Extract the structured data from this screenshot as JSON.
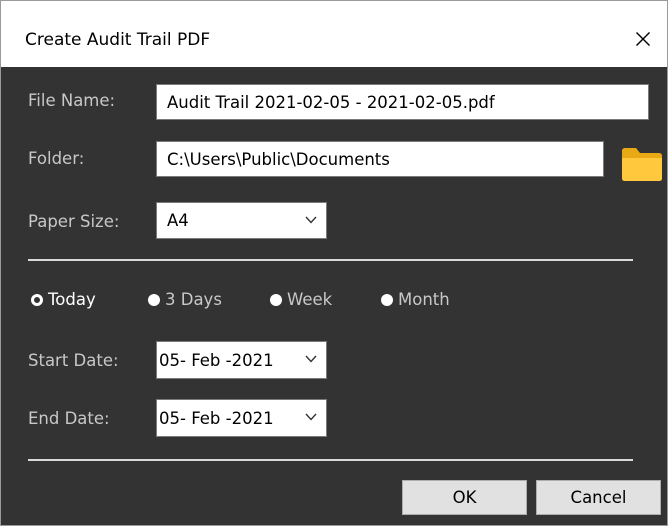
{
  "dialog": {
    "title": "Create Audit Trail PDF",
    "close_icon": "close-icon"
  },
  "form": {
    "file_name_label": "File Name:",
    "file_name_value": "Audit Trail 2021-02-05 - 2021-02-05.pdf",
    "folder_label": "Folder:",
    "folder_value": "C:\\Users\\Public\\Documents",
    "folder_icon": "folder-icon",
    "folder_icon_color": "#ffc83d",
    "paper_size_label": "Paper Size:",
    "paper_size_value": "A4"
  },
  "range": {
    "options": [
      {
        "label": "Today",
        "selected": true
      },
      {
        "label": "3 Days",
        "selected": false
      },
      {
        "label": "Week",
        "selected": false
      },
      {
        "label": "Month",
        "selected": false
      }
    ],
    "start_date_label": "Start Date:",
    "start_date_value": "05- Feb -2021",
    "end_date_label": "End Date:",
    "end_date_value": "05- Feb -2021"
  },
  "buttons": {
    "ok_label": "OK",
    "cancel_label": "Cancel"
  },
  "colors": {
    "background": "#333333",
    "label_text": "#c8c8c8",
    "divider": "#d9d9d9"
  }
}
